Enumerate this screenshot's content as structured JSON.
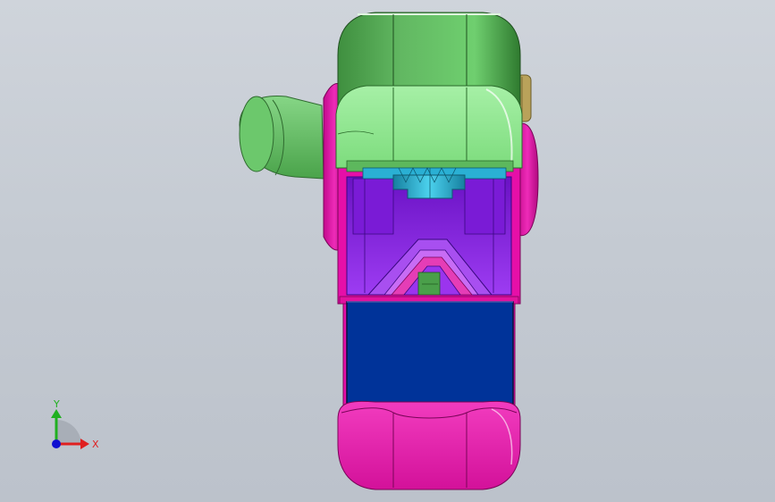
{
  "viewport": {
    "background_top": "#cfd4db",
    "background_bottom": "#bcc2cb"
  },
  "model": {
    "colors": {
      "housing_green": "#7fdd7f",
      "housing_green_dark": "#3d8c3d",
      "hose_green": "#5fbf5f",
      "body_magenta": "#e60fa8",
      "body_magenta_dark": "#b10a80",
      "cavity_purple": "#8a23e6",
      "cavity_purple_dark": "#5c0fb0",
      "gear_cyan": "#22a6c8",
      "panel_blue": "#003399",
      "knob_gold": "#b9a25a"
    }
  },
  "triad": {
    "x_label": "X",
    "y_label": "Y",
    "x_color": "#e02020",
    "y_color": "#20b020",
    "z_color": "#1010d0"
  }
}
